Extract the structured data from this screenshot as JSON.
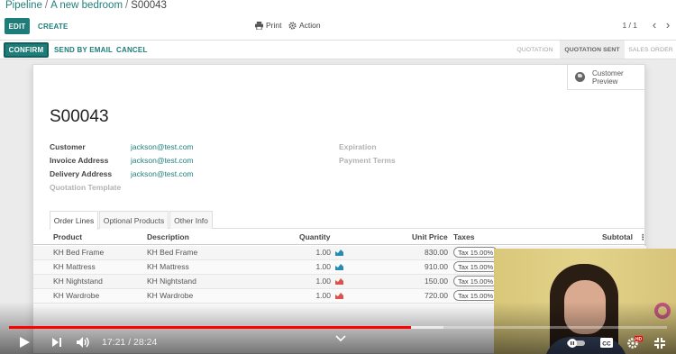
{
  "breadcrumb": {
    "pipeline": "Pipeline",
    "opportunity": "A new bedroom",
    "current": "S00043",
    "sep": "/"
  },
  "toolbar": {
    "edit_label": "EDIT",
    "create_label": "CREATE",
    "print_label": "Print",
    "action_label": "Action",
    "pager": "1 / 1",
    "prev_glyph": "‹",
    "next_glyph": "›"
  },
  "statusbar": {
    "confirm_label": "CONFIRM",
    "send_email_label": "SEND BY EMAIL",
    "cancel_label": "CANCEL",
    "stages": [
      "QUOTATION",
      "QUOTATION SENT",
      "SALES ORDER"
    ],
    "active_stage": "QUOTATION SENT"
  },
  "sheet": {
    "preview_label_1": "Customer",
    "preview_label_2": "Preview",
    "title": "S00043",
    "fields": {
      "customer_label": "Customer",
      "customer_value": "jackson@test.com",
      "invoice_label": "Invoice Address",
      "invoice_value": "jackson@test.com",
      "delivery_label": "Delivery Address",
      "delivery_value": "jackson@test.com",
      "template_label": "Quotation Template",
      "expiration_label": "Expiration",
      "terms_label": "Payment Terms"
    },
    "tabs": [
      "Order Lines",
      "Optional Products",
      "Other Info"
    ],
    "columns": {
      "product": "Product",
      "description": "Description",
      "quantity": "Quantity",
      "unit_price": "Unit Price",
      "taxes": "Taxes",
      "subtotal": "Subtotal"
    },
    "lines": [
      {
        "product": "KH Bed Frame",
        "description": "KH Bed Frame",
        "quantity": "1.00",
        "unit_price": "830.00",
        "tax": "Tax 15.00%",
        "forecast": "available"
      },
      {
        "product": "KH Mattress",
        "description": "KH Mattress",
        "quantity": "1.00",
        "unit_price": "910.00",
        "tax": "Tax 15.00%",
        "forecast": "available"
      },
      {
        "product": "KH Nightstand",
        "description": "KH Nightstand",
        "quantity": "1.00",
        "unit_price": "150.00",
        "tax": "Tax 15.00%",
        "forecast": "unavailable"
      },
      {
        "product": "KH Wardrobe",
        "description": "KH Wardrobe",
        "quantity": "1.00",
        "unit_price": "720.00",
        "tax": "Tax 15.00%",
        "forecast": "unavailable"
      }
    ]
  },
  "colors": {
    "primary": "#1f7d79",
    "link": "#21807c",
    "forecast_ok": "#2a8ab0",
    "forecast_bad": "#d9534f",
    "progress_played": "#ff0000"
  },
  "video": {
    "time": "17:21 / 28:24",
    "played_fraction": 0.611,
    "buffered_fraction": 0.66
  }
}
